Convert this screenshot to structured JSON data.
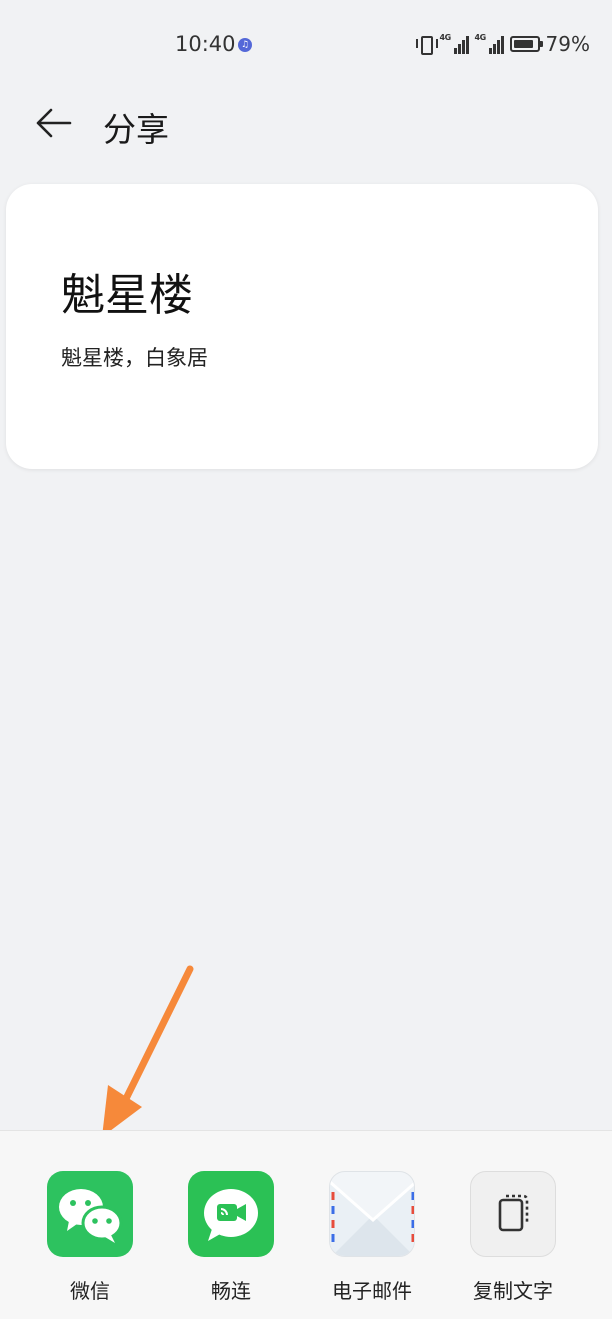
{
  "status_bar": {
    "time": "10:40",
    "signal_label_1": "4G",
    "signal_label_2": "4G",
    "battery_percent": "79%"
  },
  "header": {
    "title": "分享",
    "back_icon": "arrow-left-icon"
  },
  "card": {
    "title": "魁星楼",
    "subtitle": "魁星楼，白象居"
  },
  "share_targets": [
    {
      "label": "微信",
      "icon": "wechat-icon",
      "color": "#2dc25f"
    },
    {
      "label": "畅连",
      "icon": "changlian-icon",
      "color": "#2bc155"
    },
    {
      "label": "电子邮件",
      "icon": "mail-icon",
      "color": "#f2f5f8"
    },
    {
      "label": "复制文字",
      "icon": "copy-text-icon",
      "color": "#f0f0f0"
    }
  ],
  "colors": {
    "background": "#f1f2f4",
    "annotation_arrow": "#f6893a"
  }
}
